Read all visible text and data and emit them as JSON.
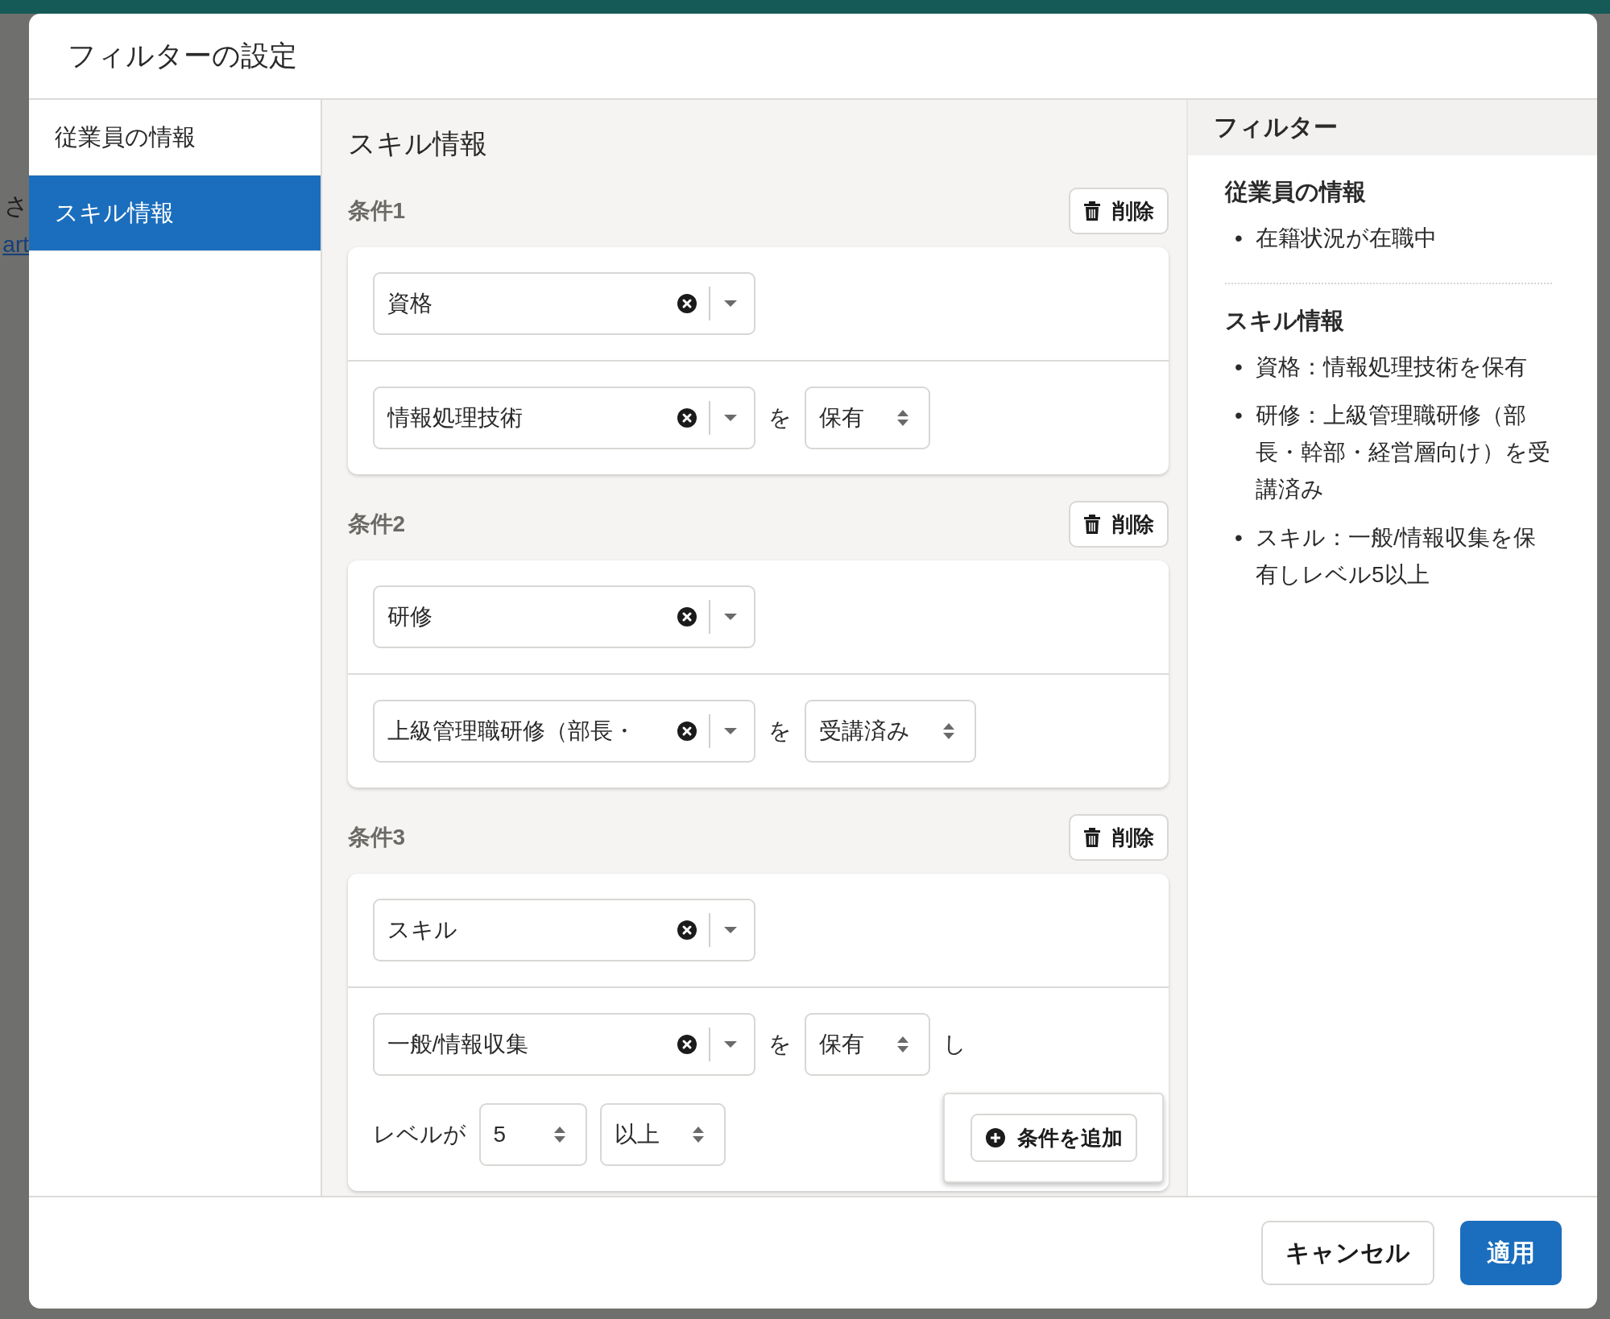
{
  "background": {
    "text": "さ",
    "link": "art"
  },
  "dialog": {
    "title": "フィルターの設定"
  },
  "nav": [
    {
      "label": "従業員の情報",
      "selected": false
    },
    {
      "label": "スキル情報",
      "selected": true
    }
  ],
  "section_title": "スキル情報",
  "conditions": [
    {
      "label": "条件1",
      "delete_label": "削除",
      "rows": [
        [
          {
            "kind": "combo",
            "value": "資格"
          }
        ],
        [
          {
            "kind": "combo",
            "value": "情報処理技術"
          },
          {
            "kind": "text",
            "value": "を"
          },
          {
            "kind": "select",
            "value": "保有"
          }
        ]
      ]
    },
    {
      "label": "条件2",
      "delete_label": "削除",
      "rows": [
        [
          {
            "kind": "combo",
            "value": "研修"
          }
        ],
        [
          {
            "kind": "combo",
            "value": "上級管理職研修（部長・"
          },
          {
            "kind": "text",
            "value": "を"
          },
          {
            "kind": "select",
            "value": "受講済み"
          }
        ]
      ]
    },
    {
      "label": "条件3",
      "delete_label": "削除",
      "rows": [
        [
          {
            "kind": "combo",
            "value": "スキル"
          }
        ],
        [
          {
            "kind": "combo",
            "value": "一般/情報収集"
          },
          {
            "kind": "text",
            "value": "を"
          },
          {
            "kind": "select",
            "value": "保有"
          },
          {
            "kind": "text",
            "value": "し"
          },
          {
            "kind": "break"
          },
          {
            "kind": "text",
            "value": "レベルが"
          },
          {
            "kind": "select",
            "value": "5"
          },
          {
            "kind": "select",
            "value": "以上"
          }
        ]
      ]
    }
  ],
  "add_condition": {
    "label": "条件を追加"
  },
  "summary": {
    "title": "フィルター",
    "bullet": "•",
    "groups": [
      {
        "heading": "従業員の情報",
        "items": [
          "在籍状況が在職中"
        ]
      },
      {
        "heading": "スキル情報",
        "items": [
          "資格：情報処理技術を保有",
          "研修：上級管理職研修（部長・幹部・経営層向け）を受講済み",
          "スキル：一般/情報収集を保有しレベル5以上"
        ]
      }
    ]
  },
  "footer": {
    "cancel": "キャンセル",
    "apply": "適用"
  }
}
